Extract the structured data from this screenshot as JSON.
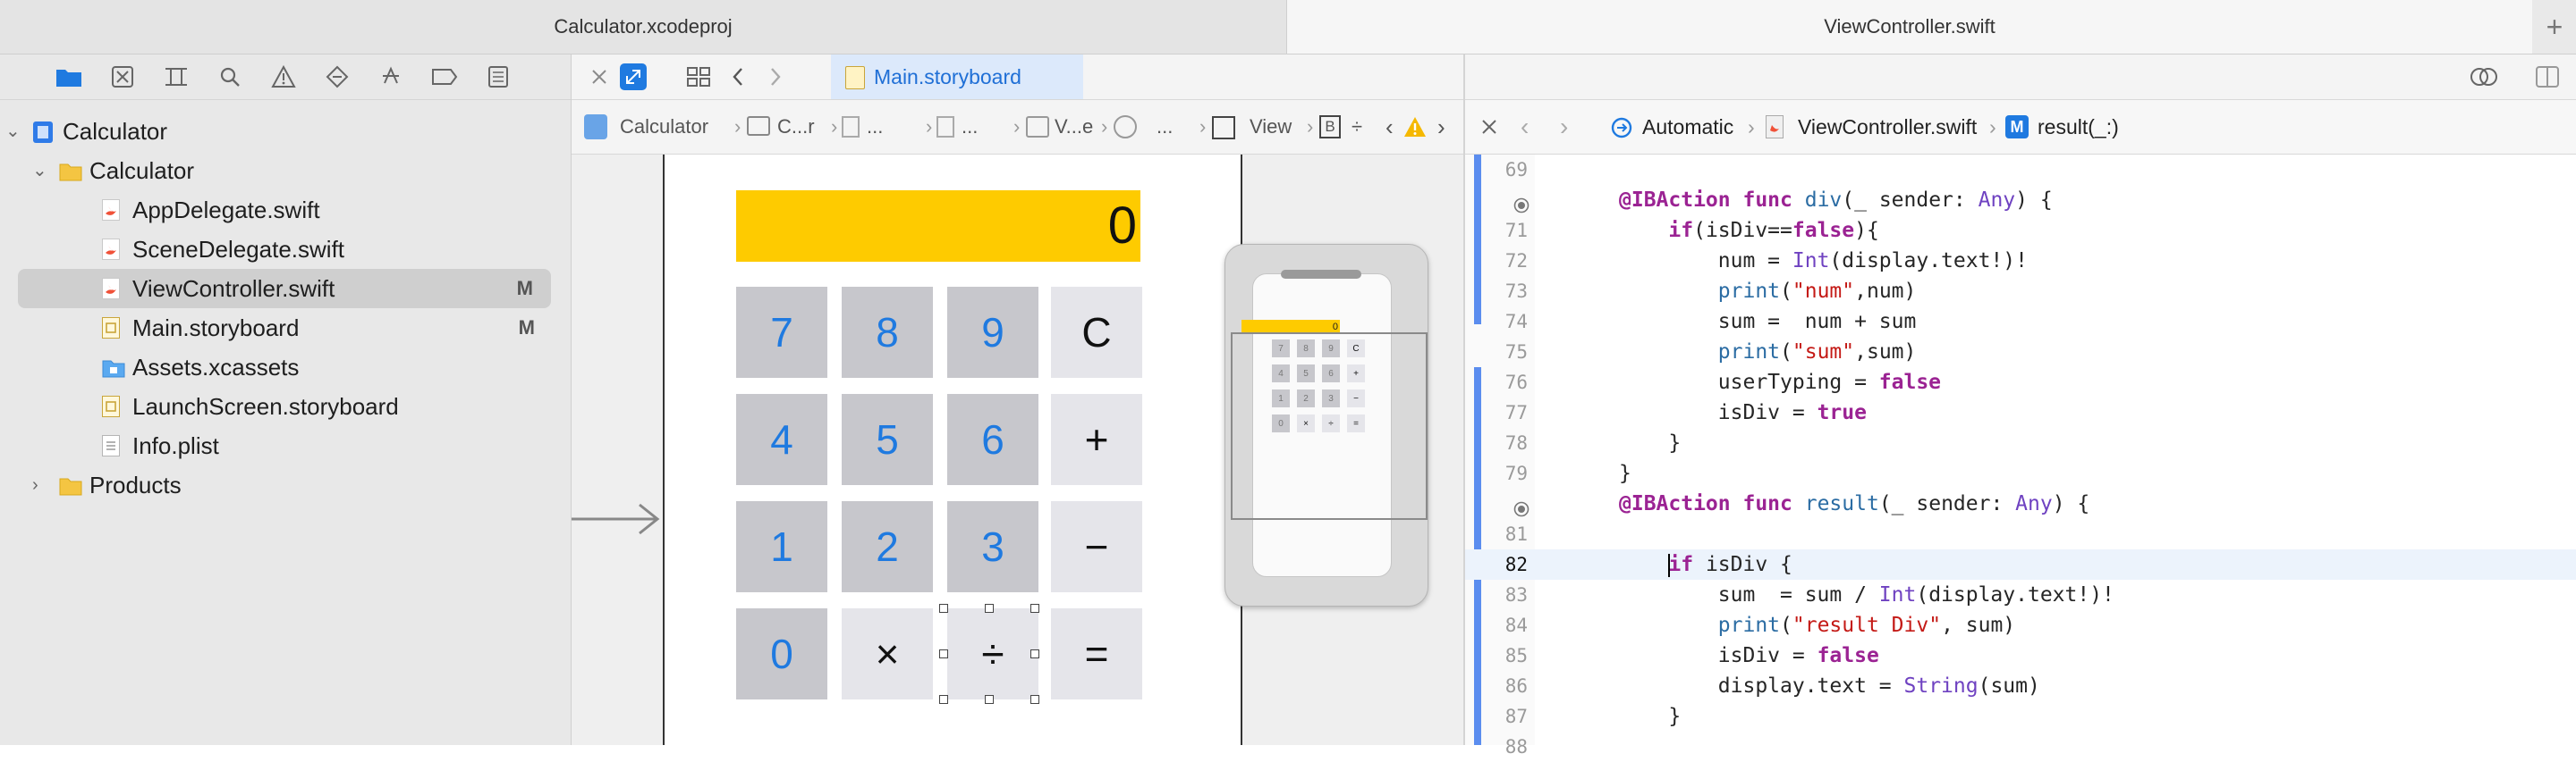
{
  "tabs": {
    "left_title": "Calculator.xcodeproj",
    "right_title": "ViewController.swift",
    "add": "+"
  },
  "navigator": {
    "items": [
      {
        "label": "Calculator",
        "icon": "project-icon",
        "level": 0,
        "disclosure": "⌄"
      },
      {
        "label": "Calculator",
        "icon": "folder-icon",
        "level": 1,
        "disclosure": "⌄"
      },
      {
        "label": "AppDelegate.swift",
        "icon": "swift-file-icon",
        "level": 2,
        "flag": ""
      },
      {
        "label": "SceneDelegate.swift",
        "icon": "swift-file-icon",
        "level": 2,
        "flag": ""
      },
      {
        "label": "ViewController.swift",
        "icon": "swift-file-icon",
        "level": 2,
        "flag": "M",
        "selected": true
      },
      {
        "label": "Main.storyboard",
        "icon": "storyboard-file-icon",
        "level": 2,
        "flag": "M"
      },
      {
        "label": "Assets.xcassets",
        "icon": "assets-folder-icon",
        "level": 2,
        "flag": ""
      },
      {
        "label": "LaunchScreen.storyboard",
        "icon": "storyboard-file-icon",
        "level": 2,
        "flag": ""
      },
      {
        "label": "Info.plist",
        "icon": "plist-file-icon",
        "level": 2,
        "flag": ""
      },
      {
        "label": "Products",
        "icon": "folder-icon",
        "level": 1,
        "disclosure": "›"
      }
    ]
  },
  "storyboard": {
    "tab_label": "Main.storyboard",
    "jump_bar": [
      "Calculator",
      "C...r",
      "...",
      "...",
      "V...e",
      "...",
      "View",
      "B",
      "÷"
    ],
    "display_value": "0",
    "keys": [
      [
        "7",
        "8",
        "9",
        "C"
      ],
      [
        "4",
        "5",
        "6",
        "+"
      ],
      [
        "1",
        "2",
        "3",
        "−"
      ],
      [
        "0",
        "×",
        "÷",
        "="
      ]
    ]
  },
  "code": {
    "jump_bar": {
      "mode": "Automatic",
      "file": "ViewController.swift",
      "symbol": "result(_:)",
      "symbol_badge": "M"
    },
    "current_line": 82,
    "lines": [
      {
        "n": "69",
        "text": ""
      },
      {
        "n": "",
        "text": "@IBAction func div(_ sender: Any) {"
      },
      {
        "n": "71",
        "text": "    if(isDiv==false){"
      },
      {
        "n": "72",
        "text": "        num = Int(display.text!)!"
      },
      {
        "n": "73",
        "text": "        print(\"num\",num)"
      },
      {
        "n": "74",
        "text": "        sum =  num + sum"
      },
      {
        "n": "75",
        "text": "        print(\"sum\",sum)"
      },
      {
        "n": "76",
        "text": "        userTyping = false"
      },
      {
        "n": "77",
        "text": "        isDiv = true"
      },
      {
        "n": "78",
        "text": "    }"
      },
      {
        "n": "79",
        "text": "}"
      },
      {
        "n": "",
        "text": "@IBAction func result(_ sender: Any) {"
      },
      {
        "n": "81",
        "text": ""
      },
      {
        "n": "82",
        "text": "    if isDiv {"
      },
      {
        "n": "83",
        "text": "        sum  = sum / Int(display.text!)!"
      },
      {
        "n": "84",
        "text": "        print(\"result Div\", sum)"
      },
      {
        "n": "85",
        "text": "        isDiv = false"
      },
      {
        "n": "86",
        "text": "        display.text = String(sum)"
      },
      {
        "n": "87",
        "text": "    }"
      },
      {
        "n": "88",
        "text": ""
      }
    ]
  },
  "colors": {
    "accent": "#1f7ae0",
    "display": "#fecb00",
    "number_key": "#c7c7cc",
    "operator_key": "#e5e5ea"
  }
}
